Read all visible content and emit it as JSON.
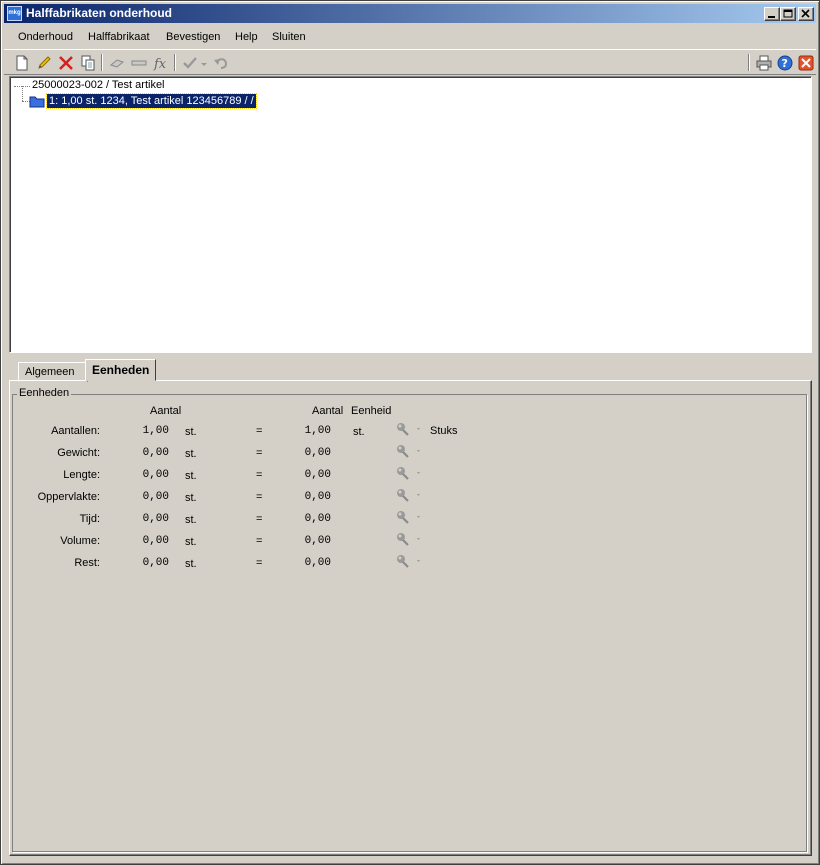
{
  "window": {
    "title": "Halffabrikaten onderhoud",
    "app_icon_text": "mkg"
  },
  "menu": {
    "items": [
      {
        "label": "Onderhoud"
      },
      {
        "label": "Halffabrikaat"
      },
      {
        "label": "Bevestigen"
      },
      {
        "label": "Help"
      },
      {
        "label": "Sluiten"
      }
    ]
  },
  "toolbar": {
    "icons": [
      "new-document-icon",
      "edit-pencil-icon",
      "delete-x-icon",
      "copy-icon",
      "eraser-icon",
      "ruler-icon",
      "formula-fx-icon",
      "confirm-check-icon",
      "undo-icon",
      "print-icon",
      "help-icon",
      "close-icon"
    ]
  },
  "tree": {
    "root": "25000023-002 / Test artikel",
    "child": "1: 1,00 st. 1234, Test artikel 123456789 /  /"
  },
  "tabs": [
    {
      "label": "Algemeen",
      "active": false
    },
    {
      "label": "Eenheden",
      "active": true
    }
  ],
  "eenheden": {
    "group_title": "Eenheden",
    "header_aantal_left": "Aantal",
    "header_aantal_right": "Aantal",
    "header_eenheid": "Eenheid",
    "rows": [
      {
        "label": "Aantallen:",
        "left_value": "1,00",
        "left_unit": "st.",
        "equals": "=",
        "right_value": "1,00",
        "right_unit": "st.",
        "unit_name": "Stuks"
      },
      {
        "label": "Gewicht:",
        "left_value": "0,00",
        "left_unit": "st.",
        "equals": "=",
        "right_value": "0,00",
        "right_unit": "",
        "unit_name": ""
      },
      {
        "label": "Lengte:",
        "left_value": "0,00",
        "left_unit": "st.",
        "equals": "=",
        "right_value": "0,00",
        "right_unit": "",
        "unit_name": ""
      },
      {
        "label": "Oppervlakte:",
        "left_value": "0,00",
        "left_unit": "st.",
        "equals": "=",
        "right_value": "0,00",
        "right_unit": "",
        "unit_name": ""
      },
      {
        "label": "Tijd:",
        "left_value": "0,00",
        "left_unit": "st.",
        "equals": "=",
        "right_value": "0,00",
        "right_unit": "",
        "unit_name": ""
      },
      {
        "label": "Volume:",
        "left_value": "0,00",
        "left_unit": "st.",
        "equals": "=",
        "right_value": "0,00",
        "right_unit": "",
        "unit_name": ""
      },
      {
        "label": "Rest:",
        "left_value": "0,00",
        "left_unit": "st.",
        "equals": "=",
        "right_value": "0,00",
        "right_unit": "",
        "unit_name": ""
      }
    ]
  },
  "colors": {
    "title_start": "#0a246a",
    "title_end": "#a6caf0",
    "selection": "#0a246a",
    "face": "#d4d0c8"
  }
}
